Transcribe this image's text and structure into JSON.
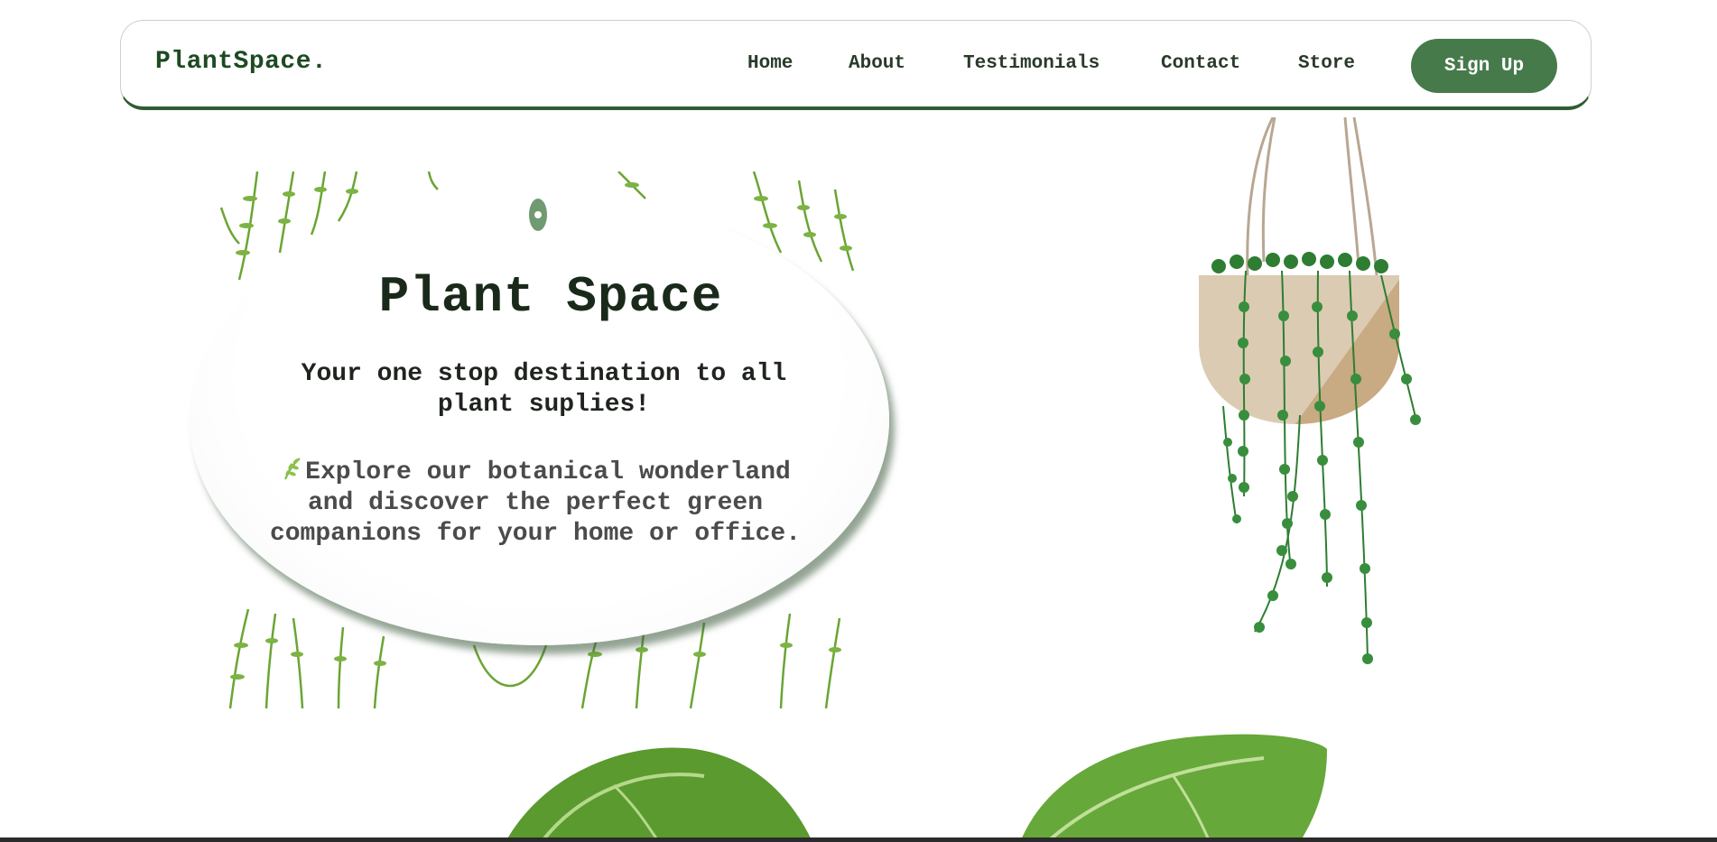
{
  "navbar": {
    "brand": "PlantSpace.",
    "links": [
      {
        "label": "Home"
      },
      {
        "label": "About"
      },
      {
        "label": "Testimonials"
      },
      {
        "label": "Contact"
      },
      {
        "label": "Store"
      }
    ],
    "signup_label": "Sign Up"
  },
  "hero": {
    "title": "Plant Space",
    "subtitle": "Your one stop destination to all plant suplies!",
    "description": "Explore our botanical wonderland and discover the perfect green companions for your home or office.",
    "description_icon": "leaf-sprig-icon"
  },
  "colors": {
    "brand_green": "#1d4a22",
    "button_green": "#477a4b",
    "nav_border": "#2f5d34",
    "vine_green": "#6aa534"
  }
}
